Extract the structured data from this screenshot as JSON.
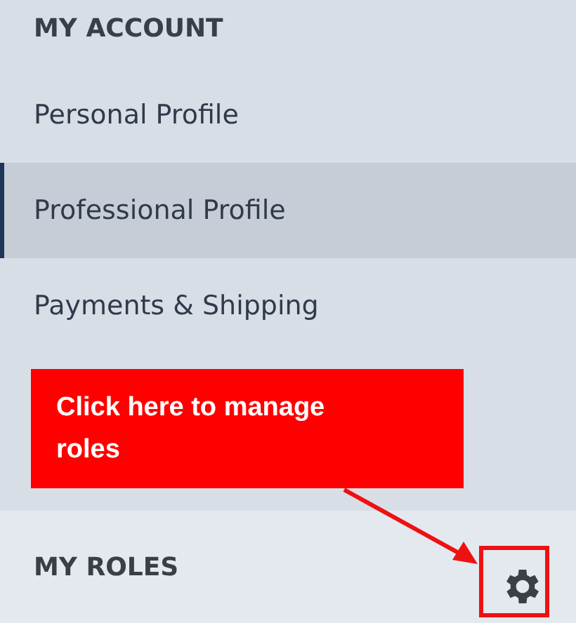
{
  "account": {
    "heading": "MY ACCOUNT",
    "items": [
      {
        "label": "Personal Profile",
        "selected": false
      },
      {
        "label": "Professional Profile",
        "selected": true
      },
      {
        "label": "Payments & Shipping",
        "selected": false
      }
    ]
  },
  "callout": {
    "text": "Click here to manage roles"
  },
  "roles": {
    "heading": "MY ROLES"
  }
}
